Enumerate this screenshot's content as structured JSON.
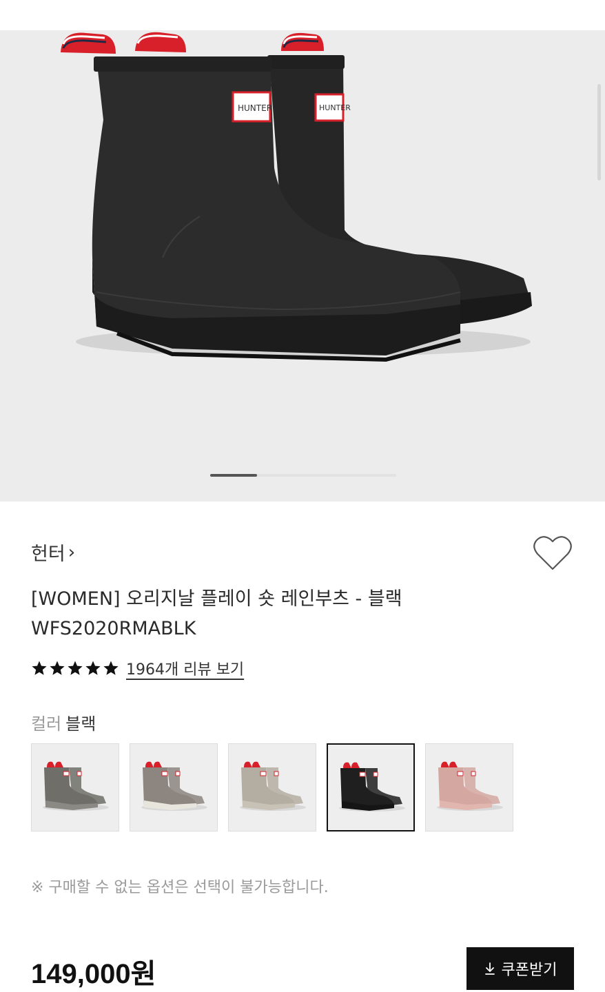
{
  "brand": {
    "name": "헌터",
    "chevron": "›"
  },
  "product": {
    "title_line1": "[WOMEN] 오리지날 플레이 숏 레인부츠 - 블랙",
    "title_line2": "WFS2020RMABLK",
    "rating_stars": 5,
    "review_link": "1964개 리뷰 보기",
    "price": "149,000원"
  },
  "color": {
    "label": "컬러",
    "value": "블랙",
    "swatches": [
      {
        "name": "gray",
        "boot": "#6f6e69",
        "sole": "#8a8984",
        "selected": false
      },
      {
        "name": "taupe-white",
        "boot": "#8c8580",
        "sole": "#e8e5dc",
        "selected": false
      },
      {
        "name": "beige",
        "boot": "#b4ada2",
        "sole": "#c7c1b6",
        "selected": false
      },
      {
        "name": "black",
        "boot": "#1f1f1f",
        "sole": "#151515",
        "selected": true
      },
      {
        "name": "pink",
        "boot": "#d4a7a0",
        "sole": "#e0b6ae",
        "selected": false
      }
    ]
  },
  "notice": "※ 구매할 수 없는 옵션은 선택이 불가능합니다.",
  "coupon": {
    "label": "쿠폰받기",
    "icon": "download-icon"
  },
  "hero": {
    "logo_text": "HUNTER",
    "pager_current": 1
  },
  "icons": {
    "wishlist": "heart-outline-icon",
    "star": "star-icon"
  },
  "colors": {
    "accent": "#111111",
    "muted": "#9a9a9a",
    "hero_bg": "#ececec"
  }
}
